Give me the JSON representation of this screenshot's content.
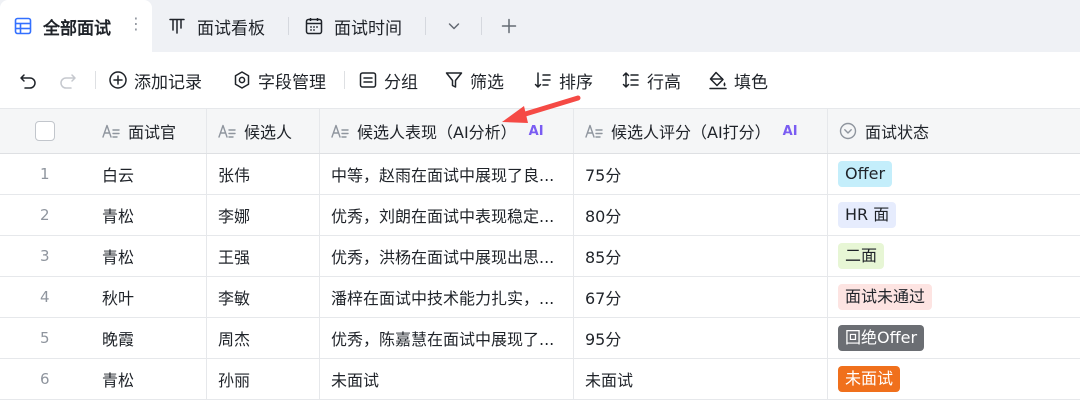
{
  "tabs": [
    {
      "label": "全部面试",
      "icon": "grid-view-icon",
      "active": true
    },
    {
      "label": "面试看板",
      "icon": "kanban-icon",
      "active": false
    },
    {
      "label": "面试时间",
      "icon": "calendar-icon",
      "active": false
    }
  ],
  "tab_more_glyph": "⋮",
  "toolbar": {
    "add_record": "添加记录",
    "field_manage": "字段管理",
    "group": "分组",
    "filter": "筛选",
    "sort": "排序",
    "row_height": "行高",
    "fill_color": "填色"
  },
  "columns": [
    {
      "label": "面试官",
      "icon": "text-field-icon",
      "ai": ""
    },
    {
      "label": "候选人",
      "icon": "text-field-icon",
      "ai": ""
    },
    {
      "label": "候选人表现（AI分析）",
      "icon": "text-field-icon",
      "ai": "AI"
    },
    {
      "label": "候选人评分（AI打分）",
      "icon": "text-field-icon",
      "ai": "AI"
    },
    {
      "label": "面试状态",
      "icon": "single-select-icon",
      "ai": ""
    }
  ],
  "rows": [
    {
      "num": "1",
      "interviewer": "白云",
      "candidate": "张伟",
      "performance": "中等，赵雨在面试中展现了良...",
      "score": "75分",
      "status": "Offer"
    },
    {
      "num": "2",
      "interviewer": "青松",
      "candidate": "李娜",
      "performance": "优秀，刘朗在面试中表现稳定...",
      "score": "80分",
      "status": "HR 面"
    },
    {
      "num": "3",
      "interviewer": "青松",
      "candidate": "王强",
      "performance": "优秀，洪杨在面试中展现出思...",
      "score": "85分",
      "status": "二面"
    },
    {
      "num": "4",
      "interviewer": "秋叶",
      "candidate": "李敏",
      "performance": "潘梓在面试中技术能力扎实，...",
      "score": "67分",
      "status": "面试未通过"
    },
    {
      "num": "5",
      "interviewer": "晚霞",
      "candidate": "周杰",
      "performance": "优秀，陈嘉慧在面试中展现了...",
      "score": "95分",
      "status": "回绝Offer"
    },
    {
      "num": "6",
      "interviewer": "青松",
      "candidate": "孙丽",
      "performance": "未面试",
      "score": "未面试",
      "status": "未面试"
    }
  ],
  "status_colors": {
    "Offer": {
      "bg": "#c4eefb",
      "fg": "#1f2329"
    },
    "HR 面": {
      "bg": "#e6ecfd",
      "fg": "#1f2329"
    },
    "二面": {
      "bg": "#e7f6d5",
      "fg": "#1f2329"
    },
    "面试未通过": {
      "bg": "#fde4e2",
      "fg": "#1f2329"
    },
    "回绝Offer": {
      "bg": "#6b6e73",
      "fg": "#ffffff"
    },
    "未面试": {
      "bg": "#f0701c",
      "fg": "#ffffff"
    }
  },
  "accent_color": "#3370ff",
  "annotation_arrow_color": "#f54a45"
}
